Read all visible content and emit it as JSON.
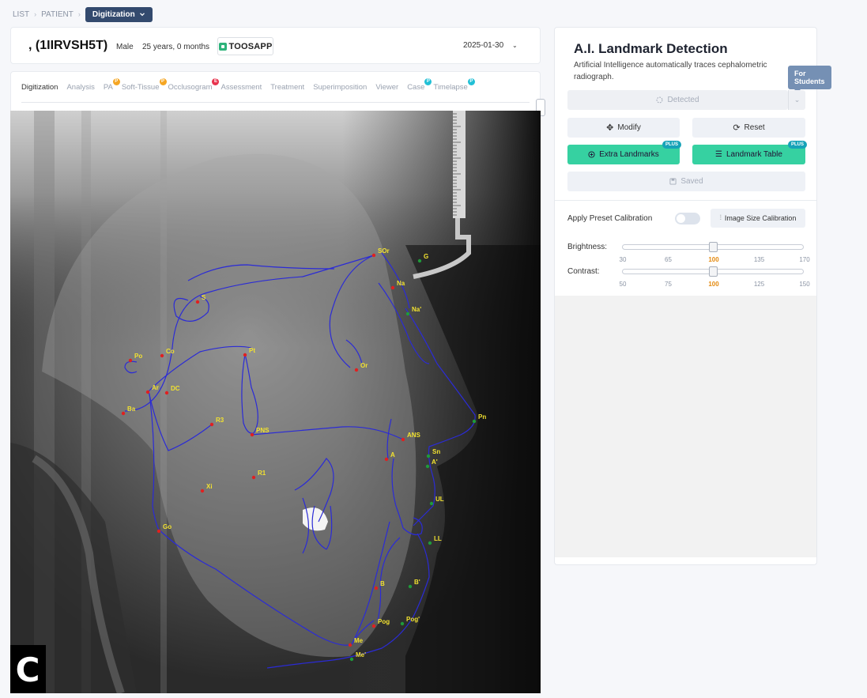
{
  "breadcrumb": {
    "items": [
      "LIST",
      "PATIENT"
    ],
    "current": "Digitization"
  },
  "patient": {
    "name": ", (1IIRVSH5T)",
    "sex": "Male",
    "age": "25 years, 0 months",
    "logo_text": "TOOSAPP",
    "date": "2025-01-30"
  },
  "tabs": [
    {
      "label": "Digitization",
      "active": true,
      "badge": ""
    },
    {
      "label": "Analysis",
      "badge": ""
    },
    {
      "label": "PA",
      "badge": "P",
      "badge_color": "#f5a623"
    },
    {
      "label": "Soft-Tissue",
      "badge": "P",
      "badge_color": "#f5a623"
    },
    {
      "label": "Occlusogram",
      "badge": "E",
      "badge_color": "#e8344e"
    },
    {
      "label": "Assessment",
      "badge": ""
    },
    {
      "label": "Treatment",
      "badge": ""
    },
    {
      "label": "Superimposition",
      "badge": ""
    },
    {
      "label": "Viewer",
      "badge": ""
    },
    {
      "label": "Case",
      "badge": "P",
      "badge_color": "#22c0d6"
    },
    {
      "label": "Timelapse",
      "badge": "P",
      "badge_color": "#22c0d6"
    }
  ],
  "xray": {
    "watermark": "C",
    "landmarks_red": [
      {
        "label": "SOr"
      },
      {
        "label": "Na"
      },
      {
        "label": "S"
      },
      {
        "label": "Po"
      },
      {
        "label": "Co"
      },
      {
        "label": "Pt"
      },
      {
        "label": "Or"
      },
      {
        "label": "Ar"
      },
      {
        "label": "DC"
      },
      {
        "label": "Ba"
      },
      {
        "label": "R3"
      },
      {
        "label": "PNS"
      },
      {
        "label": "ANS"
      },
      {
        "label": "A"
      },
      {
        "label": "R1"
      },
      {
        "label": "Xi"
      },
      {
        "label": "Go"
      },
      {
        "label": "B"
      },
      {
        "label": "Pog"
      },
      {
        "label": "Me"
      }
    ],
    "landmarks_green": [
      {
        "label": "G"
      },
      {
        "label": "Na'"
      },
      {
        "label": "Pn"
      },
      {
        "label": "Sn"
      },
      {
        "label": "A'"
      },
      {
        "label": "UL"
      },
      {
        "label": "LL"
      },
      {
        "label": "B'"
      },
      {
        "label": "Pog'"
      },
      {
        "label": "Me'"
      }
    ]
  },
  "panel": {
    "title": "A.I. Landmark Detection",
    "description": "Artificial Intelligence automatically traces cephalometric radiograph.",
    "tooltip": "For Students",
    "detected_label": "Detected",
    "modify_label": "Modify",
    "reset_label": "Reset",
    "extra_landmarks_label": "Extra Landmarks",
    "landmark_table_label": "Landmark Table",
    "plus_badge": "PLUS",
    "saved_label": "Saved",
    "apply_preset_label": "Apply Preset Calibration",
    "image_size_calibration_label": "Image Size Calibration",
    "brightness_label": "Brightness:",
    "brightness_ticks": [
      "30",
      "65",
      "100",
      "135",
      "170"
    ],
    "brightness_value": 100,
    "contrast_label": "Contrast:",
    "contrast_ticks": [
      "50",
      "75",
      "100",
      "125",
      "150"
    ],
    "contrast_value": 100
  },
  "colors": {
    "accent_dark": "#334a6e",
    "green_button": "#36d1a1",
    "plus_badge": "#16a3b8",
    "trace": "#2b2bd6",
    "landmark_red": "#e02020",
    "landmark_green": "#1f9a3a",
    "landmark_label": "#f2e230",
    "tick_current": "#e48a10"
  }
}
